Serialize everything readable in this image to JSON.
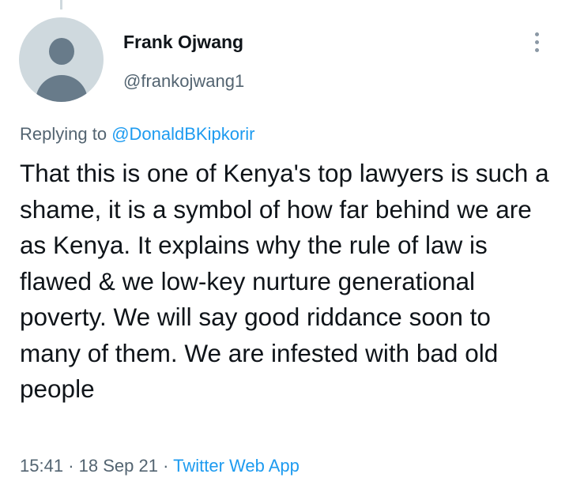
{
  "author": {
    "display_name": "Frank Ojwang",
    "handle": "@frankojwang1"
  },
  "reply": {
    "prefix": "Replying to",
    "mention": "@DonaldBKipkorir"
  },
  "tweet": {
    "text": "That this is one of Kenya's top lawyers is such a shame, it is a symbol of how far behind we are as Kenya. It explains why the rule of law is flawed & we low-key nurture generational poverty. We will say good riddance soon to many of them. We are infested with bad old people"
  },
  "meta": {
    "time": "15:41",
    "separator": "·",
    "date": "18 Sep 21",
    "source": "Twitter Web App"
  },
  "icons": {
    "avatar": "default-profile-icon",
    "more": "more-options-icon"
  },
  "colors": {
    "accent": "#1d9bf0",
    "text_primary": "#0f1419",
    "text_secondary": "#536471",
    "avatar_bg": "#cfd9de",
    "avatar_fg": "#687b8a"
  }
}
